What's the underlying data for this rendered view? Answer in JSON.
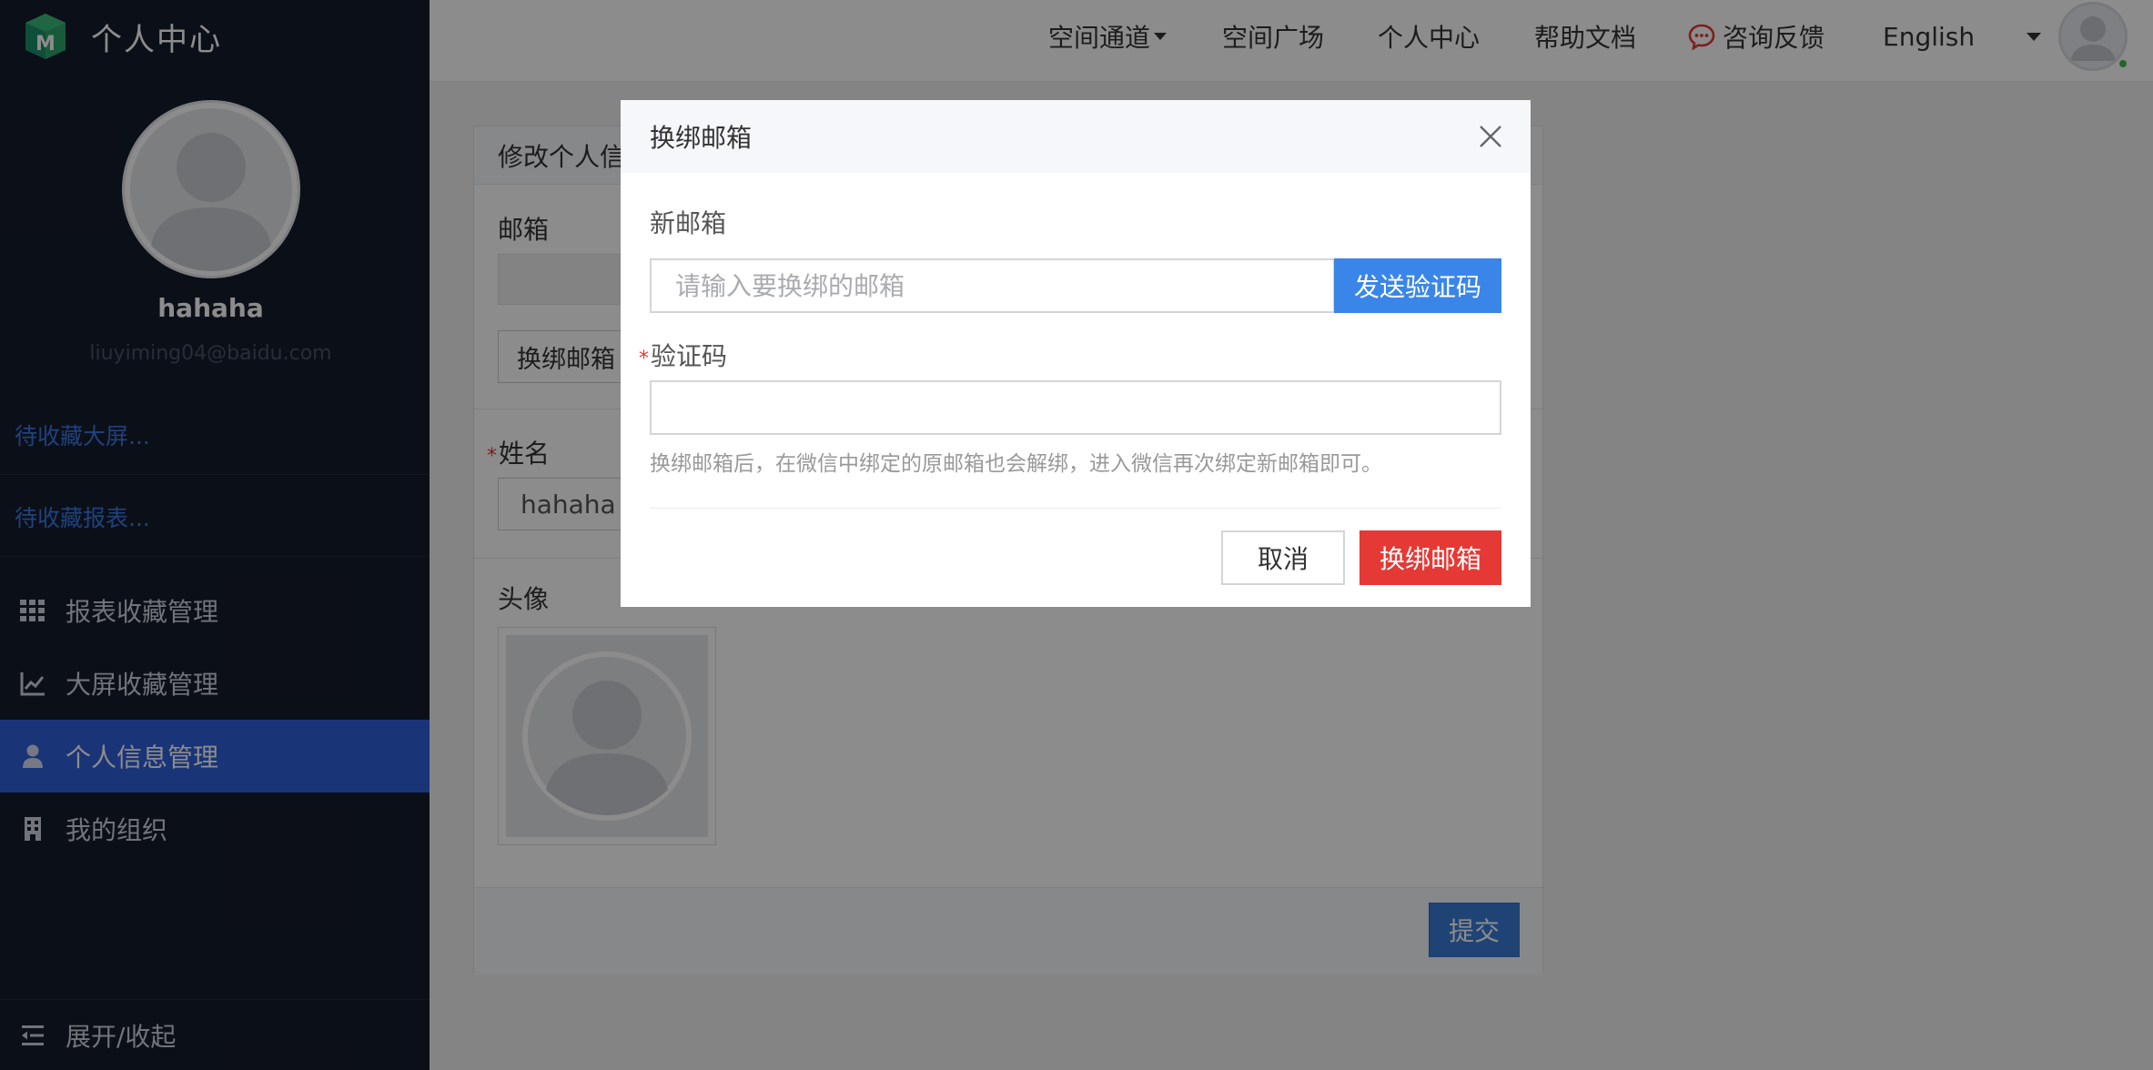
{
  "app": {
    "title": "个人中心"
  },
  "profile": {
    "name": "hahaha",
    "email": "liuyiming04@baidu.com"
  },
  "sidebar": {
    "favorites": [
      {
        "label": "待收藏大屏..."
      },
      {
        "label": "待收藏报表..."
      }
    ],
    "items": [
      {
        "label": "报表收藏管理",
        "icon": "grid-icon"
      },
      {
        "label": "大屏收藏管理",
        "icon": "line-chart-icon"
      },
      {
        "label": "个人信息管理",
        "icon": "user-icon",
        "active": true
      },
      {
        "label": "我的组织",
        "icon": "building-icon"
      }
    ],
    "collapse_label": "展开/收起"
  },
  "header": {
    "nav": [
      {
        "label": "空间通道"
      },
      {
        "label": "空间广场"
      },
      {
        "label": "个人中心"
      },
      {
        "label": "帮助文档"
      },
      {
        "label": "咨询反馈"
      },
      {
        "label": "English"
      }
    ]
  },
  "main": {
    "panel_title": "修改个人信",
    "email_label": "邮箱",
    "change_email_button": "换绑邮箱",
    "name_label": "姓名",
    "name_value": "hahaha",
    "avatar_label": "头像",
    "submit_button": "提交"
  },
  "modal": {
    "title": "换绑邮箱",
    "new_email_label": "新邮箱",
    "new_email_placeholder": "请输入要换绑的邮箱",
    "send_code_button": "发送验证码",
    "code_label": "验证码",
    "hint": "换绑邮箱后，在微信中绑定的原邮箱也会解绑，进入微信再次绑定新邮箱即可。",
    "cancel_button": "取消",
    "confirm_button": "换绑邮箱"
  },
  "colors": {
    "sidebar_bg": "#151c2c",
    "active_nav": "#2f5fd9",
    "link": "#3a78e0",
    "primary": "#3a86e8",
    "danger": "#e53935",
    "online": "#3cbc4a"
  }
}
